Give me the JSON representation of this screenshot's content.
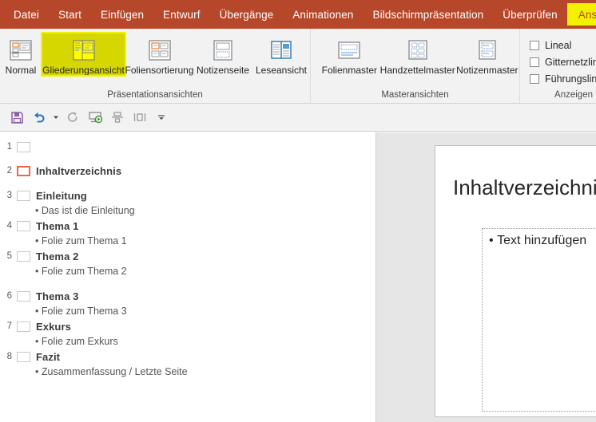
{
  "ribbon": {
    "tabs": [
      {
        "label": "Datei",
        "active": false
      },
      {
        "label": "Start",
        "active": false
      },
      {
        "label": "Einfügen",
        "active": false
      },
      {
        "label": "Entwurf",
        "active": false
      },
      {
        "label": "Übergänge",
        "active": false
      },
      {
        "label": "Animationen",
        "active": false
      },
      {
        "label": "Bildschirmpräsentation",
        "active": false
      },
      {
        "label": "Überprüfen",
        "active": false
      },
      {
        "label": "Ansicht",
        "active": true
      }
    ],
    "accent_color": "#b7472a",
    "highlight_color": "#f2f200",
    "groups": {
      "presentation_views": {
        "label": "Präsentationsansichten",
        "buttons": [
          {
            "label": "Normal",
            "icon": "normal-view-icon",
            "selected": false
          },
          {
            "label": "Gliederungsansicht",
            "icon": "outline-view-icon",
            "selected": true
          },
          {
            "label": "Foliensortierung",
            "icon": "slide-sorter-icon",
            "selected": false
          },
          {
            "label": "Notizenseite",
            "icon": "notes-page-icon",
            "selected": false
          },
          {
            "label": "Leseansicht",
            "icon": "reading-view-icon",
            "selected": false
          }
        ]
      },
      "master_views": {
        "label": "Masteransichten",
        "buttons": [
          {
            "label": "Folienmaster",
            "icon": "slide-master-icon"
          },
          {
            "label": "Handzettelmaster",
            "icon": "handout-master-icon"
          },
          {
            "label": "Notizenmaster",
            "icon": "notes-master-icon"
          }
        ]
      },
      "show": {
        "label": "Anzeigen",
        "checkboxes": [
          {
            "label": "Lineal",
            "checked": false
          },
          {
            "label": "Gitternetzlinien",
            "checked": false
          },
          {
            "label": "Führungslinien",
            "checked": false
          }
        ]
      }
    }
  },
  "quick_access": {
    "buttons": [
      {
        "name": "save-icon",
        "title": "Speichern"
      },
      {
        "name": "undo-icon",
        "title": "Rückgängig"
      },
      {
        "name": "undo-dropdown-caret-icon",
        "title": "Rückgängig Optionen"
      },
      {
        "name": "redo-icon",
        "title": "Wiederholen"
      },
      {
        "name": "start-slideshow-icon",
        "title": "Bildschirmpräsentation starten"
      },
      {
        "name": "align-center-icon",
        "title": "Ausrichten"
      },
      {
        "name": "distribute-icon",
        "title": "Verteilen"
      },
      {
        "name": "customize-qat-caret-icon",
        "title": "Symbolleiste anpassen"
      }
    ]
  },
  "outline": {
    "slides": [
      {
        "number": "1",
        "title": "",
        "selected": false,
        "bullets": []
      },
      {
        "number": "2",
        "title": "Inhaltverzeichnis",
        "selected": true,
        "bullets": []
      },
      {
        "number": "3",
        "title": "Einleitung",
        "selected": false,
        "bullets": [
          "Das ist die Einleitung"
        ]
      },
      {
        "number": "4",
        "title": "Thema 1",
        "selected": false,
        "bullets": [
          "Folie zum Thema 1"
        ]
      },
      {
        "number": "5",
        "title": "Thema 2",
        "selected": false,
        "bullets": [
          "Folie zum Thema 2"
        ]
      },
      {
        "number": "6",
        "title": "Thema 3",
        "selected": false,
        "bullets": [
          "Folie zum Thema 3"
        ]
      },
      {
        "number": "7",
        "title": "Exkurs",
        "selected": false,
        "bullets": [
          "Folie zum Exkurs"
        ]
      },
      {
        "number": "8",
        "title": "Fazit",
        "selected": false,
        "bullets": [
          "Zusammenfassung / Letzte Seite"
        ]
      }
    ],
    "bullet_glyph": "•",
    "selection_color": "#ea6a47"
  },
  "slide_preview": {
    "title": "Inhaltverzeichnis",
    "body_placeholder": "Text hinzufügen",
    "bullet_glyph": "•"
  }
}
